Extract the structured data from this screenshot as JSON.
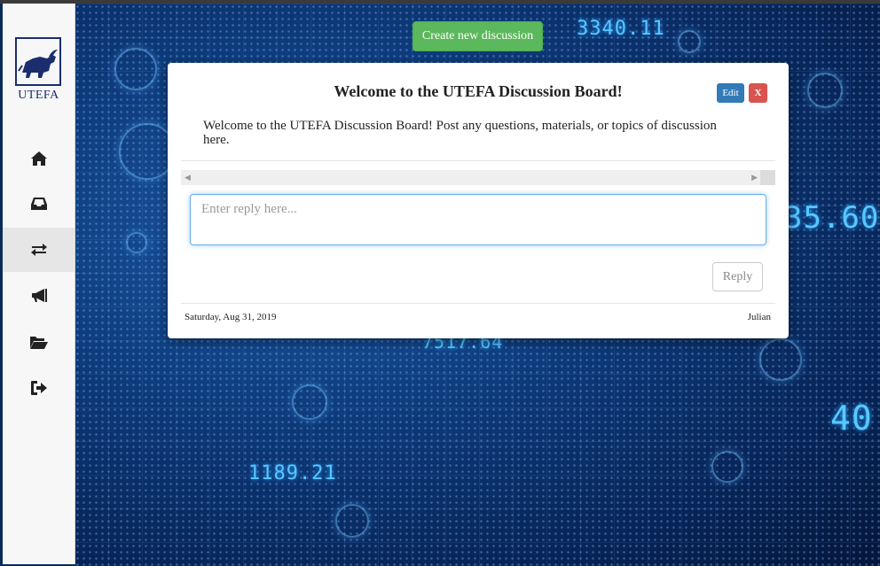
{
  "app": {
    "logo_text": "UTEFA"
  },
  "sidebar": {
    "items": [
      {
        "icon": "home-icon"
      },
      {
        "icon": "inbox-icon"
      },
      {
        "icon": "exchange-icon",
        "active": true
      },
      {
        "icon": "megaphone-icon"
      },
      {
        "icon": "folder-open-icon"
      },
      {
        "icon": "sign-out-icon"
      }
    ]
  },
  "background": {
    "tickers": [
      "3340.11",
      "35.60",
      "7517.64",
      "1189.21",
      "40"
    ]
  },
  "toolbar": {
    "create_label": "Create new discussion"
  },
  "discussion": {
    "title": "Welcome to the UTEFA Discussion Board!",
    "edit_label": "Edit",
    "close_label": "X",
    "body": "Welcome to the UTEFA Discussion Board! Post any questions, materials, or topics of discussion here.",
    "reply_placeholder": "Enter reply here...",
    "reply_label": "Reply",
    "date": "Saturday, Aug 31, 2019",
    "author": "Julian"
  },
  "colors": {
    "create_button": "#5cb85c",
    "edit_button": "#337ab7",
    "close_button": "#d9534f",
    "brand": "#1a2e6e"
  }
}
